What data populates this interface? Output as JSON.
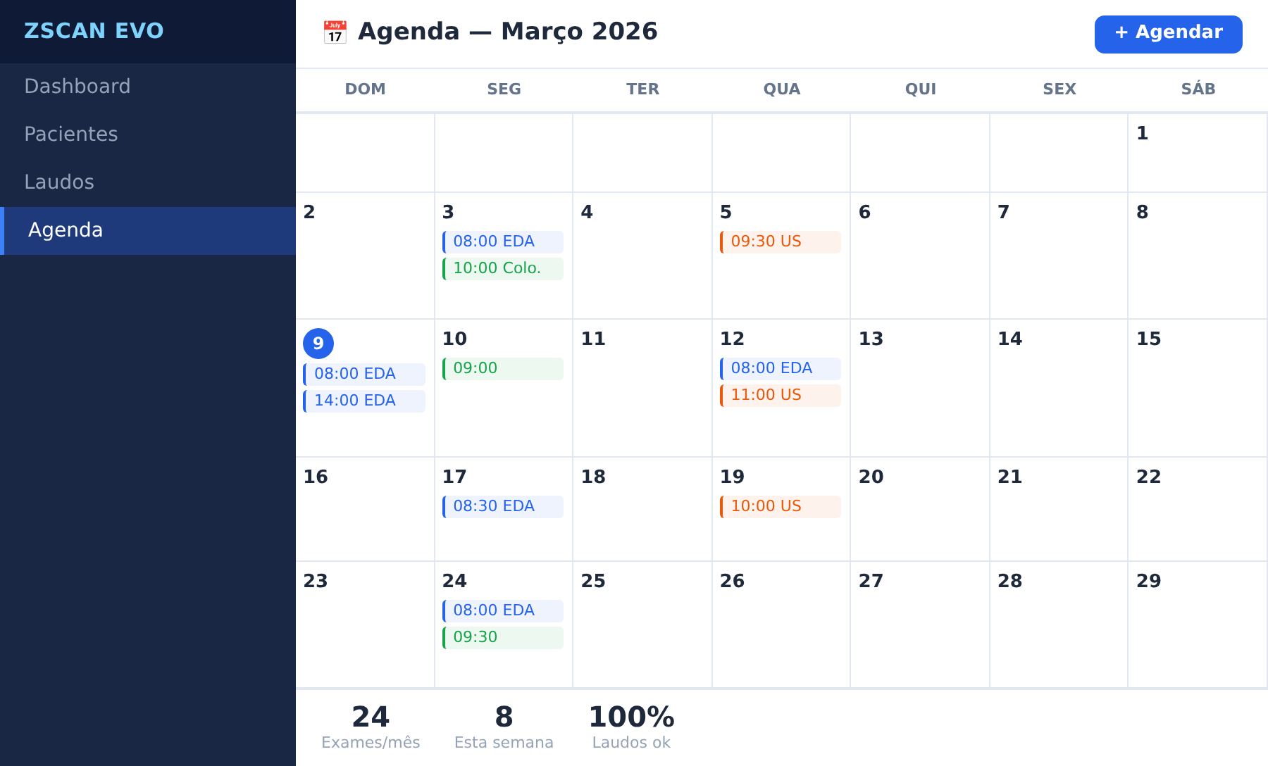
{
  "sidebar": {
    "brand": "ZSCAN EVO",
    "items": [
      {
        "label": "Dashboard",
        "selected": false
      },
      {
        "label": "Pacientes",
        "selected": false
      },
      {
        "label": "Laudos",
        "selected": false
      },
      {
        "label": "Agenda",
        "selected": true
      }
    ]
  },
  "header": {
    "icon": "📅",
    "title": "Agenda — Março 2026",
    "button": "+ Agendar"
  },
  "weekdays": [
    "DOM",
    "SEG",
    "TER",
    "QUA",
    "QUI",
    "SEX",
    "SÁB"
  ],
  "weeks": [
    [
      {
        "kind": "blank"
      },
      {
        "kind": "blank"
      },
      {
        "kind": "blank"
      },
      {
        "kind": "blank"
      },
      {
        "kind": "blank"
      },
      {
        "kind": "blank"
      },
      {
        "kind": "day",
        "day": "1",
        "today": false
      }
    ],
    [
      {
        "kind": "day",
        "day": "2",
        "today": false
      },
      {
        "kind": "day",
        "day": "3",
        "today": false,
        "events": [
          {
            "label": "08:00 EDA",
            "color": "#2563eb"
          },
          {
            "label": "10:00 Colo.",
            "color": "#16a34a"
          }
        ]
      },
      {
        "kind": "day",
        "day": "4",
        "today": false
      },
      {
        "kind": "day",
        "day": "5",
        "today": false,
        "events": [
          {
            "label": "09:30 US",
            "color": "#ea580c"
          }
        ]
      },
      {
        "kind": "day",
        "day": "6",
        "today": false
      },
      {
        "kind": "day",
        "day": "7",
        "today": false
      },
      {
        "kind": "day",
        "day": "8",
        "today": false
      }
    ],
    [
      {
        "kind": "day",
        "day": "9",
        "today": true,
        "events": [
          {
            "label": "08:00 EDA",
            "color": "#2563eb"
          },
          {
            "label": "14:00 EDA",
            "color": "#2563eb"
          }
        ]
      },
      {
        "kind": "day",
        "day": "10",
        "today": false,
        "events": [
          {
            "label": "09:00",
            "color": "#16a34a"
          }
        ]
      },
      {
        "kind": "day",
        "day": "11",
        "today": false
      },
      {
        "kind": "day",
        "day": "12",
        "today": false,
        "events": [
          {
            "label": "08:00 EDA",
            "color": "#2563eb"
          },
          {
            "label": "11:00 US",
            "color": "#ea580c"
          }
        ]
      },
      {
        "kind": "day",
        "day": "13",
        "today": false
      },
      {
        "kind": "day",
        "day": "14",
        "today": false
      },
      {
        "kind": "day",
        "day": "15",
        "today": false
      }
    ],
    [
      {
        "kind": "day",
        "day": "16",
        "today": false
      },
      {
        "kind": "day",
        "day": "17",
        "today": false,
        "events": [
          {
            "label": "08:30 EDA",
            "color": "#2563eb"
          }
        ]
      },
      {
        "kind": "day",
        "day": "18",
        "today": false
      },
      {
        "kind": "day",
        "day": "19",
        "today": false,
        "events": [
          {
            "label": "10:00 US",
            "color": "#ea580c"
          }
        ]
      },
      {
        "kind": "day",
        "day": "20",
        "today": false
      },
      {
        "kind": "day",
        "day": "21",
        "today": false
      },
      {
        "kind": "day",
        "day": "22",
        "today": false
      }
    ],
    [
      {
        "kind": "day",
        "day": "23",
        "today": false
      },
      {
        "kind": "day",
        "day": "24",
        "today": false,
        "events": [
          {
            "label": "08:00 EDA",
            "color": "#2563eb"
          },
          {
            "label": "09:30",
            "color": "#16a34a"
          }
        ]
      },
      {
        "kind": "day",
        "day": "25",
        "today": false
      },
      {
        "kind": "day",
        "day": "26",
        "today": false
      },
      {
        "kind": "day",
        "day": "27",
        "today": false
      },
      {
        "kind": "day",
        "day": "28",
        "today": false
      },
      {
        "kind": "day",
        "day": "29",
        "today": false
      }
    ]
  ],
  "stats": [
    {
      "value": "24",
      "label": "Exames/mês"
    },
    {
      "value": "8",
      "label": "Esta semana"
    },
    {
      "value": "100%",
      "label": "Laudos ok"
    }
  ]
}
